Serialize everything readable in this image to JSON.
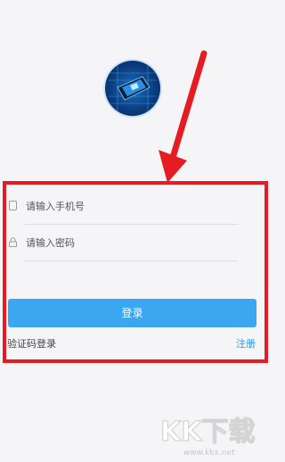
{
  "form": {
    "phone_placeholder": "请输入手机号",
    "password_placeholder": "请输入密码",
    "login_label": "登录",
    "sms_login_label": "验证码登录",
    "register_label": "注册"
  },
  "watermark": {
    "logo_text": "KK下载",
    "url": "www.kkx.net"
  },
  "colors": {
    "accent": "#3aa7f0",
    "register_link": "#2b96e6",
    "annotation_red": "#e51c23"
  },
  "icons": [
    "app-logo-icon",
    "phone-icon",
    "lock-icon"
  ]
}
